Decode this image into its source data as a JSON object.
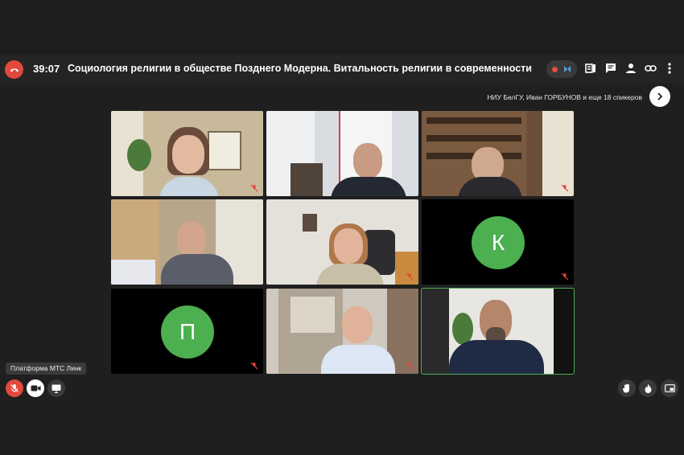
{
  "call": {
    "timer": "39:07",
    "title": "Социология религии в обществе Позднего Модерна. Витальность религии в современности",
    "speakers_label": "НИУ БелГУ, Иван ГОРБУНОВ и еще 18 спикеров"
  },
  "tiles": [
    {
      "kind": "video",
      "muted": true
    },
    {
      "kind": "video",
      "muted": false
    },
    {
      "kind": "video",
      "muted": true
    },
    {
      "kind": "video",
      "muted": false
    },
    {
      "kind": "video",
      "muted": true
    },
    {
      "kind": "avatar",
      "initial": "К",
      "muted": true
    },
    {
      "kind": "avatar",
      "initial": "П",
      "muted": true
    },
    {
      "kind": "video",
      "muted": true
    },
    {
      "kind": "video",
      "muted": false,
      "active": true
    }
  ],
  "footer": {
    "tooltip": "Платформа МТС Линк"
  },
  "colors": {
    "background": "#1f1f1f",
    "end_call": "#e2483c",
    "avatar": "#4caf50",
    "active_outline": "#4caf50"
  },
  "icons": [
    "end-call-icon",
    "record-icon",
    "notes-icon",
    "chat-icon",
    "participants-icon",
    "link-icon",
    "more-icon",
    "chevron-right-icon",
    "mic-off-icon",
    "camera-icon",
    "screen-share-icon",
    "raise-hand-icon",
    "fire-icon",
    "picture-in-picture-icon"
  ]
}
